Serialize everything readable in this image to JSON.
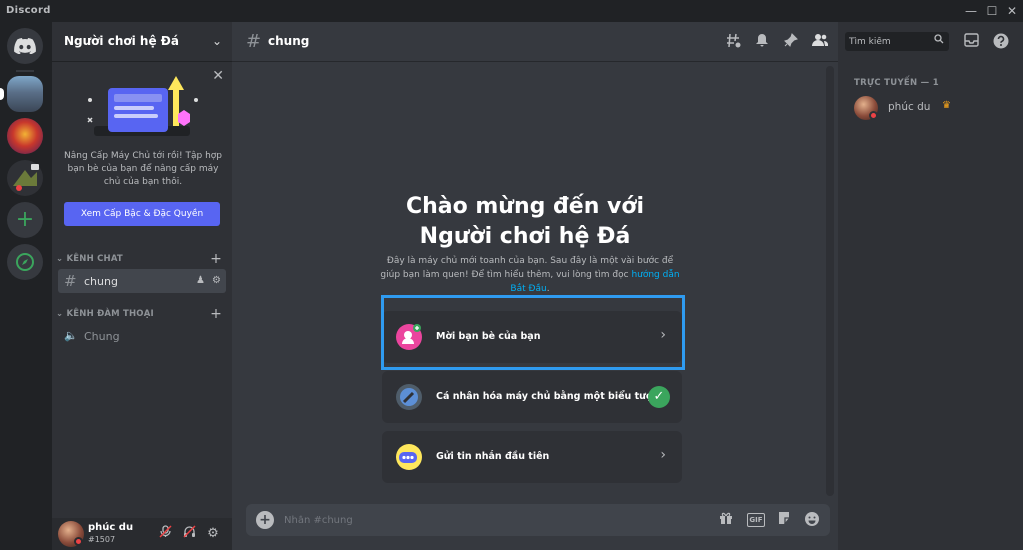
{
  "window": {
    "app_name": "Discord",
    "minimize": "—",
    "maximize": "☐",
    "close": "✕"
  },
  "colors": {
    "blurple": "#5865f2",
    "green": "#3ba55d",
    "link": "#00aff4",
    "dnd": "#ed4245",
    "highlight": "#2f9bf0"
  },
  "rail": {
    "add_server": "+"
  },
  "sidebar": {
    "guild_name": "Người chơi hệ Đá",
    "boost": {
      "text": "Nâng Cấp Máy Chủ tới rồi! Tập hợp bạn bè của bạn để nâng cấp máy chủ của bạn thôi.",
      "button": "Xem Cấp Bậc & Đặc Quyền"
    },
    "text_category": "KÊNH CHAT",
    "text_channel": "chung",
    "voice_category": "KÊNH ĐÀM THOẠI",
    "voice_channel": "Chung"
  },
  "user": {
    "name": "phúc du",
    "tag": "#1507"
  },
  "header": {
    "channel": "chung"
  },
  "welcome": {
    "title_line1": "Chào mừng đến với",
    "title_line2": "Người chơi hệ Đá",
    "sub_text": "Đây là máy chủ mới toanh của bạn. Sau đây là một vài bước để giúp bạn làm quen! Để tìm hiểu thêm, vui lòng tìm đọc ",
    "sub_link": "hướng dẫn Bắt Đầu",
    "sub_end": "."
  },
  "tasks": [
    {
      "label": "Mời bạn bè của bạn",
      "done": false
    },
    {
      "label": "Cá nhân hóa máy chủ bằng một biểu tượng",
      "done": true
    },
    {
      "label": "Gửi tin nhắn đầu tiên",
      "done": false
    }
  ],
  "composer": {
    "placeholder": "Nhắn #chung",
    "gif": "GIF"
  },
  "members": {
    "search_placeholder": "Tìm kiếm",
    "online_header": "TRỰC TUYẾN — 1",
    "list": [
      {
        "name": "phúc du",
        "owner": true
      }
    ]
  }
}
